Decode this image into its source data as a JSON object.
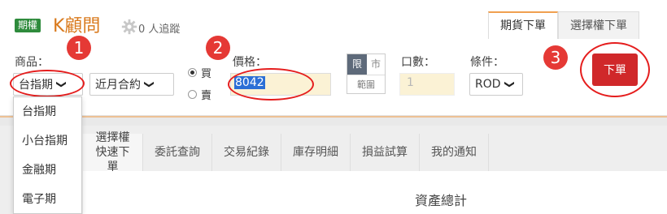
{
  "header": {
    "badge": "期權",
    "brand": "K顧問",
    "followers": "0 人追蹤",
    "tabs": [
      {
        "label": "期貨下單",
        "active": true
      },
      {
        "label": "選擇權下單",
        "active": false
      }
    ]
  },
  "form": {
    "product_label": "商品：",
    "product_value": "台指期",
    "contract_value": "近月合約",
    "buy_label": "買",
    "sell_label": "賣",
    "side_selected": "買",
    "price_label": "價格：",
    "price_value": "8042",
    "limit_label": "限",
    "market_label": "市",
    "range_label": "範圍",
    "qty_label": "口數：",
    "qty_placeholder": "1",
    "condition_label": "條件：",
    "condition_value": "ROD",
    "order_button": "下單"
  },
  "dropdown": {
    "items": [
      "台指期",
      "小台指期",
      "金融期",
      "電子期"
    ]
  },
  "annotations": [
    "1",
    "2",
    "3"
  ],
  "nav": {
    "items": [
      {
        "label": "選擇權\n快速下單",
        "active": true
      },
      {
        "label": "委託查詢",
        "active": false
      },
      {
        "label": "交易紀錄",
        "active": false
      },
      {
        "label": "庫存明細",
        "active": false
      },
      {
        "label": "損益試算",
        "active": false
      },
      {
        "label": "我的通知",
        "active": false
      }
    ]
  },
  "content": {
    "section_title": "資產總計"
  },
  "colors": {
    "brand_orange": "#d97a1d",
    "order_red": "#d0282a",
    "annotation_red": "#e53935"
  }
}
